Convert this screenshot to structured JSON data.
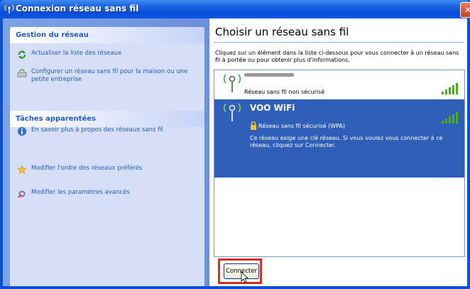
{
  "window": {
    "title": "Connexion réseau sans fil",
    "close_icon": "close-icon"
  },
  "sidebar": {
    "network_panel": {
      "title": "Gestion du réseau",
      "items": [
        {
          "label": "Actualiser la liste des réseaux",
          "icon": "refresh-icon"
        },
        {
          "label": "Configurer un réseau sans fil pour la maison ou une petite entreprise",
          "icon": "wizard-icon"
        }
      ]
    },
    "related_panel": {
      "title": "Tâches apparentées",
      "items": [
        {
          "label": "En savoir plus à propos des réseaux sans fil",
          "icon": "info-icon"
        },
        {
          "label": "Modifier l'ordre des réseaux préférés",
          "icon": "star-icon"
        },
        {
          "label": "Modifier les paramètres avancés",
          "icon": "settings-icon"
        }
      ]
    }
  },
  "main": {
    "title": "Choisir un réseau sans fil",
    "instructions": "Cliquez sur un élément dans la liste ci-dessous pour vous connecter à un réseau sans fil à portée ou pour obtenir plus d'informations.",
    "networks": [
      {
        "ssid": "",
        "status": "Réseau sans fil non sécurisé",
        "signal": 5,
        "selected": false
      },
      {
        "ssid": "VOO WiFi",
        "status": "Réseau sans fil sécurisé (WPA)",
        "signal": 5,
        "selected": true,
        "description": "Ce réseau exige une clé réseau. Si vous voulez vous connecter à ce réseau, cliquez sur Connecter."
      }
    ],
    "connect_label": "Connecter"
  },
  "colors": {
    "title_blue": "#0a4ed8",
    "selection": "#2f5fb8",
    "highlight_box": "#d6301d",
    "signal_green": "#4caf1c"
  }
}
